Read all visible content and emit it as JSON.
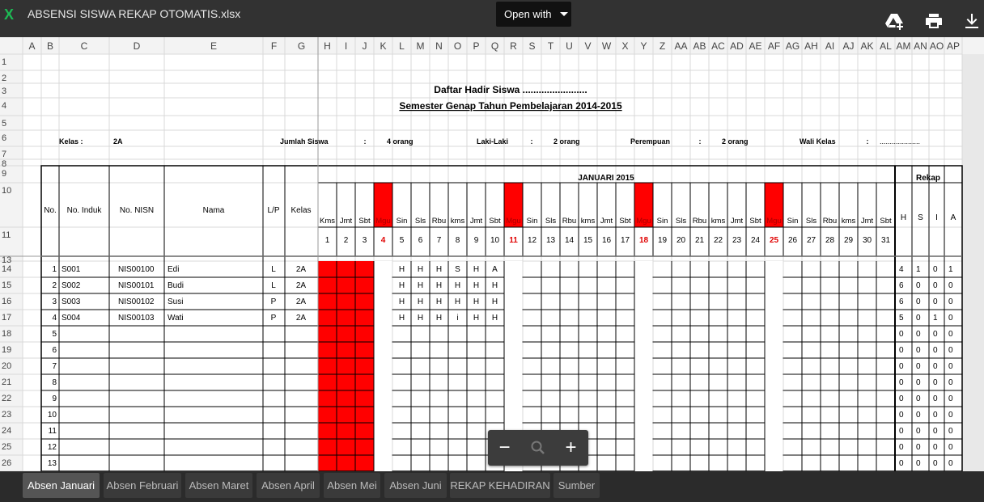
{
  "app": {
    "title": "ABSENSI SISWA REKAP OTOMATIS.xlsx",
    "open_with": "Open with",
    "icons": [
      "drive-add-icon",
      "print-icon",
      "download-icon"
    ]
  },
  "cols": [
    "A",
    "B",
    "C",
    "D",
    "E",
    "F",
    "G",
    "H",
    "I",
    "J",
    "K",
    "L",
    "M",
    "N",
    "O",
    "P",
    "Q",
    "R",
    "S",
    "T",
    "U",
    "V",
    "W",
    "X",
    "Y",
    "Z",
    "AA",
    "AB",
    "AC",
    "AD",
    "AE",
    "AF",
    "AG",
    "AH",
    "AI",
    "AJ",
    "AK",
    "AL",
    "AM",
    "AN",
    "AO",
    "AP"
  ],
  "row_numbers": [
    "1",
    "2",
    "3",
    "4",
    "5",
    "6",
    "7",
    "8",
    "9",
    "10",
    "11",
    "13",
    "14",
    "15",
    "16",
    "17",
    "18",
    "19",
    "20",
    "21",
    "22",
    "23",
    "24",
    "25",
    "26"
  ],
  "sheet": {
    "title": "Daftar Hadir Siswa ........................",
    "subtitle": "Semester Genap Tahun Pembelajaran 2014-2015",
    "info": {
      "kelas_label": "Kelas   :",
      "kelas_value": "2A",
      "jumlah_label": "Jumlah Siswa",
      "jumlah_value": "4 orang",
      "laki_label": "Laki-Laki",
      "laki_value": "2 orang",
      "perempuan_label": "Perempuan",
      "perempuan_value": "2 orang",
      "wali_label": "Wali Kelas",
      "wali_value": "....................",
      "colon": ":"
    },
    "headers": {
      "no": "No.",
      "induk": "No. Induk",
      "nisn": "No. NISN",
      "nama": "Nama",
      "lp": "L/P",
      "kelas": "Kelas",
      "month": "JANUARI 2015",
      "rekap": "Rekap",
      "rekap_cols": [
        "H",
        "S",
        "I",
        "A"
      ]
    },
    "days": [
      "Kms",
      "Jmt",
      "Sbt",
      "Mgu",
      "Sin",
      "Sls",
      "Rbu",
      "kms",
      "Jmt",
      "Sbt",
      "Mgu",
      "Sin",
      "Sls",
      "Rbu",
      "kms",
      "Jmt",
      "Sbt",
      "Mgu",
      "Sin",
      "Sls",
      "Rbu",
      "kms",
      "Jmt",
      "Sbt",
      "Mgu",
      "Sin",
      "Sls",
      "Rbu",
      "kms",
      "Jmt",
      "Sbt"
    ],
    "dates": [
      "1",
      "2",
      "3",
      "4",
      "5",
      "6",
      "7",
      "8",
      "9",
      "10",
      "11",
      "12",
      "13",
      "14",
      "15",
      "16",
      "17",
      "18",
      "19",
      "20",
      "21",
      "22",
      "23",
      "24",
      "25",
      "26",
      "27",
      "28",
      "29",
      "30",
      "31"
    ],
    "sunday_dates": [
      "4",
      "11",
      "18",
      "25"
    ],
    "students": [
      {
        "no": "1",
        "induk": "S001",
        "nisn": "NIS00100",
        "nama": "Edi",
        "lp": "L",
        "kelas": "2A",
        "att": [
          "",
          "",
          "",
          "",
          "H",
          "H",
          "H",
          "S",
          "H",
          "A"
        ],
        "rekap": [
          "4",
          "1",
          "0",
          "1"
        ]
      },
      {
        "no": "2",
        "induk": "S002",
        "nisn": "NIS00101",
        "nama": "Budi",
        "lp": "L",
        "kelas": "2A",
        "att": [
          "",
          "",
          "",
          "",
          "H",
          "H",
          "H",
          "H",
          "H",
          "H"
        ],
        "rekap": [
          "6",
          "0",
          "0",
          "0"
        ]
      },
      {
        "no": "3",
        "induk": "S003",
        "nisn": "NIS00102",
        "nama": "Susi",
        "lp": "P",
        "kelas": "2A",
        "att": [
          "",
          "",
          "",
          "",
          "H",
          "H",
          "H",
          "H",
          "H",
          "H"
        ],
        "rekap": [
          "6",
          "0",
          "0",
          "0"
        ]
      },
      {
        "no": "4",
        "induk": "S004",
        "nisn": "NIS00103",
        "nama": "Wati",
        "lp": "P",
        "kelas": "2A",
        "att": [
          "",
          "",
          "",
          "",
          "H",
          "H",
          "H",
          "i",
          "H",
          "H"
        ],
        "rekap": [
          "5",
          "0",
          "1",
          "0"
        ]
      },
      {
        "no": "5",
        "rekap": [
          "0",
          "0",
          "0",
          "0"
        ]
      },
      {
        "no": "6",
        "rekap": [
          "0",
          "0",
          "0",
          "0"
        ]
      },
      {
        "no": "7",
        "rekap": [
          "0",
          "0",
          "0",
          "0"
        ]
      },
      {
        "no": "8",
        "rekap": [
          "0",
          "0",
          "0",
          "0"
        ]
      },
      {
        "no": "9",
        "rekap": [
          "0",
          "0",
          "0",
          "0"
        ]
      },
      {
        "no": "10",
        "rekap": [
          "0",
          "0",
          "0",
          "0"
        ]
      },
      {
        "no": "11",
        "rekap": [
          "0",
          "0",
          "0",
          "0"
        ]
      },
      {
        "no": "12",
        "rekap": [
          "0",
          "0",
          "0",
          "0"
        ]
      },
      {
        "no": "13",
        "rekap": [
          "0",
          "0",
          "0",
          "0"
        ]
      }
    ]
  },
  "colors": {
    "red": "#ff0000",
    "sunday_text": "#e00000"
  },
  "tabs": [
    {
      "label": "Absen Januari",
      "active": true
    },
    {
      "label": "Absen Februari"
    },
    {
      "label": "Absen Maret"
    },
    {
      "label": "Absen April"
    },
    {
      "label": "Absen Mei"
    },
    {
      "label": "Absen Juni"
    },
    {
      "label": "REKAP KEHADIRAN"
    },
    {
      "label": "Sumber"
    }
  ],
  "zoom": {
    "minus": "−",
    "plus": "+"
  }
}
